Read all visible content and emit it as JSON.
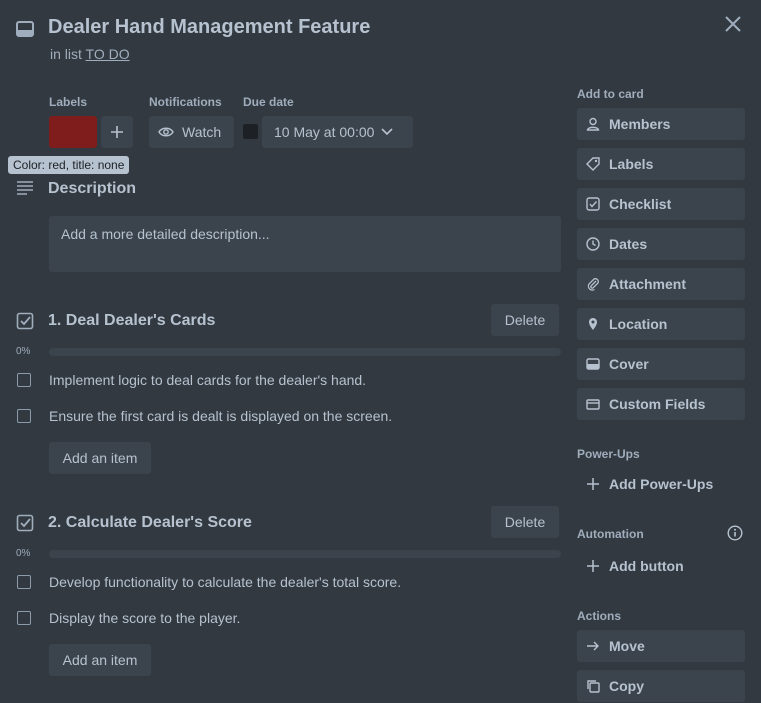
{
  "card": {
    "title": "Dealer Hand Management Feature",
    "in_list_prefix": "in list",
    "list_name": "TO DO"
  },
  "meta": {
    "labels_heading": "Labels",
    "notifications_heading": "Notifications",
    "due_date_heading": "Due date",
    "watch_label": "Watch",
    "due_value": "10 May at 00:00",
    "label_color": "#7f1d1d",
    "label_tooltip": "Color: red, title: none"
  },
  "description": {
    "heading": "Description",
    "placeholder": "Add a more detailed description..."
  },
  "checklists": [
    {
      "title": "1. Deal Dealer's Cards",
      "delete_label": "Delete",
      "progress_text": "0%",
      "progress": 0,
      "items": [
        "Implement logic to deal cards for the dealer's hand.",
        "Ensure the first card is dealt is displayed on the screen."
      ],
      "add_item_label": "Add an item"
    },
    {
      "title": "2. Calculate Dealer's Score",
      "delete_label": "Delete",
      "progress_text": "0%",
      "progress": 0,
      "items": [
        "Develop functionality to calculate the dealer's total score.",
        "Display the score to the player."
      ],
      "add_item_label": "Add an item"
    }
  ],
  "sidebar": {
    "add_to_card_heading": "Add to card",
    "add_to_card": [
      {
        "label": "Members",
        "icon": "person-icon"
      },
      {
        "label": "Labels",
        "icon": "tag-icon"
      },
      {
        "label": "Checklist",
        "icon": "checklist-icon"
      },
      {
        "label": "Dates",
        "icon": "clock-icon"
      },
      {
        "label": "Attachment",
        "icon": "paperclip-icon"
      },
      {
        "label": "Location",
        "icon": "location-pin-icon"
      },
      {
        "label": "Cover",
        "icon": "cover-icon"
      },
      {
        "label": "Custom Fields",
        "icon": "custom-fields-icon"
      }
    ],
    "powerups_heading": "Power-Ups",
    "add_powerups_label": "Add Power-Ups",
    "automation_heading": "Automation",
    "add_button_label": "Add button",
    "actions_heading": "Actions",
    "actions": [
      {
        "label": "Move",
        "icon": "arrow-right-icon"
      },
      {
        "label": "Copy",
        "icon": "copy-icon"
      }
    ]
  }
}
